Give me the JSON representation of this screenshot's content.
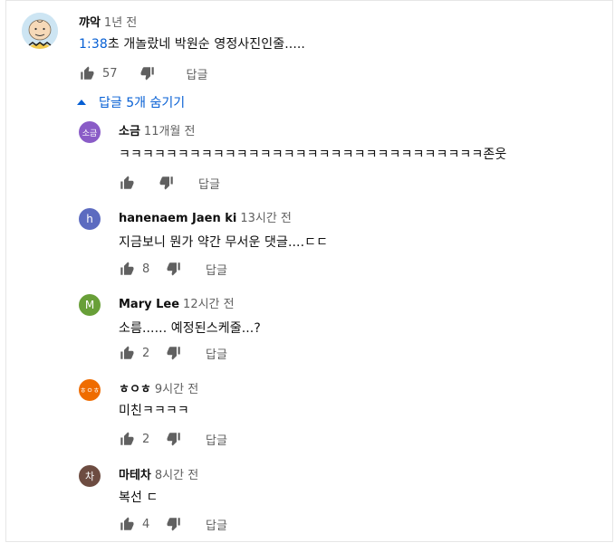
{
  "top_comment": {
    "author": "꺄악",
    "time": "1년 전",
    "timestamp": "1:38",
    "text": "초 개놀랐네 박원순 영정사진인줄.....",
    "likes": "57",
    "reply_label": "답글"
  },
  "replies_toggle": {
    "label": "답글 5개 숨기기"
  },
  "replies": [
    {
      "author": "소금",
      "time": "11개월 전",
      "avatar_letter": "소금",
      "avatar_color": "#8a5cc7",
      "text": "ㅋㅋㅋㅋㅋㅋㅋㅋㅋㅋㅋㅋㅋㅋㅋㅋㅋㅋㅋㅋㅋㅋㅋㅋㅋㅋㅋㅋㅋㅋㅋ존웃",
      "likes": "",
      "reply_label": "답글"
    },
    {
      "author": "hanenaem Jaen ki",
      "time": "13시간 전",
      "avatar_letter": "h",
      "avatar_color": "#5c6bc0",
      "text": "지금보니 뭔가 약간 무서운 댓글....ㄷㄷ",
      "likes": "8",
      "reply_label": "답글"
    },
    {
      "author": "Mary Lee",
      "time": "12시간 전",
      "avatar_letter": "M",
      "avatar_color": "#689f38",
      "text": "소름...... 예정된스케줄...?",
      "likes": "2",
      "reply_label": "답글"
    },
    {
      "author": "ㅎㅇㅎ",
      "time": "9시간 전",
      "avatar_letter": "ㅎㅇㅎ",
      "avatar_color": "#ef6c00",
      "text": "미친ㅋㅋㅋㅋ",
      "likes": "2",
      "reply_label": "답글"
    },
    {
      "author": "마테차",
      "time": "8시간 전",
      "avatar_letter": "차",
      "avatar_color": "#6d4c41",
      "text": "복선 ㄷ",
      "likes": "4",
      "reply_label": "답글"
    }
  ],
  "icons": {
    "like": "thumbs-up-icon",
    "dislike": "thumbs-down-icon",
    "toggle": "caret-up-icon"
  }
}
